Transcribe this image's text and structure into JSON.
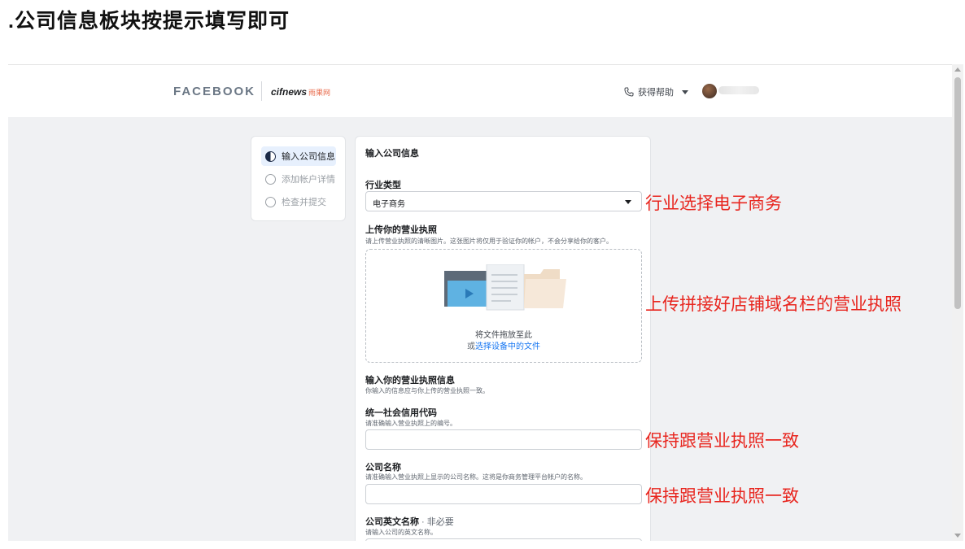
{
  "heading": ".公司信息板块按提示填写即可",
  "topbar": {
    "logo_facebook": "FACEBOOK",
    "logo_cifnews": "cifnews",
    "logo_cifnews_cn": "雨果网",
    "help_label": "获得帮助"
  },
  "steps": [
    {
      "label": "输入公司信息",
      "active": true
    },
    {
      "label": "添加帐户详情",
      "active": false
    },
    {
      "label": "检查并提交",
      "active": false
    }
  ],
  "form": {
    "title": "输入公司信息",
    "industry_label": "行业类型",
    "industry_value": "电子商务",
    "upload_label": "上传你的营业执照",
    "upload_hint": "请上传营业执照的清晰图片。这张图片将仅用于验证你的帐户，不会分享给你的客户。",
    "drop_text": "将文件拖放至此",
    "drop_or": "或",
    "drop_link": "选择设备中的文件",
    "license_info_label": "输入你的营业执照信息",
    "license_info_hint": "你输入的信息应与你上传的营业执照一致。",
    "credit_code_label": "统一社会信用代码",
    "credit_code_hint": "请准确输入营业执照上的编号。",
    "company_name_label": "公司名称",
    "company_name_hint": "请准确输入营业执照上显示的公司名称。这将是你商务管理平台帐户的名称。",
    "english_name_label": "公司英文名称",
    "english_name_optional": " · 非必要",
    "english_name_hint": "请输入公司的英文名称。"
  },
  "annotations": {
    "industry": "行业选择电子商务",
    "upload": "上传拼接好店铺域名栏的营业执照",
    "credit_code": "保持跟营业执照一致",
    "company_name": "保持跟营业执照一致"
  },
  "colors": {
    "annotation": "#e8261f",
    "link": "#1877f2",
    "active_step_bg": "#e7f0fd"
  }
}
